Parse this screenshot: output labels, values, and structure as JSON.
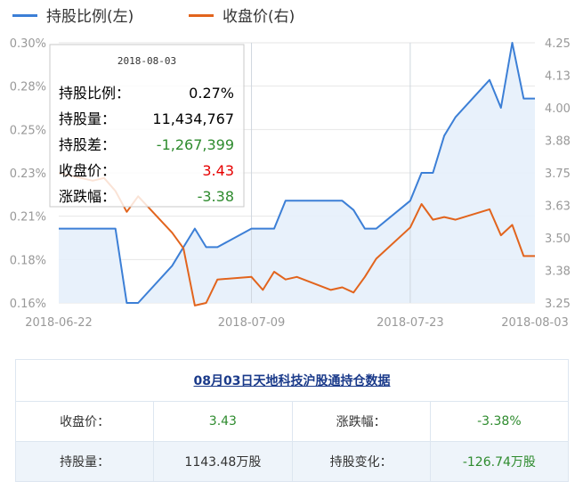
{
  "chart_data": {
    "type": "line",
    "legend": [
      {
        "name": "持股比例(左)",
        "color": "#3c7fd6"
      },
      {
        "name": "收盘价(右)",
        "color": "#e2641d"
      }
    ],
    "x_ticks": [
      "2018-06-22",
      "2018-07-09",
      "2018-07-23",
      "2018-08-03"
    ],
    "y_left": {
      "ticks": [
        "0.30%",
        "0.28%",
        "0.25%",
        "0.23%",
        "0.21%",
        "0.18%",
        "0.16%"
      ],
      "ylim": [
        0.16,
        0.3
      ]
    },
    "y_right": {
      "ticks": [
        "4.25",
        "4.13",
        "4.00",
        "3.88",
        "3.75",
        "3.63",
        "3.50",
        "3.38",
        "3.25"
      ],
      "ylim": [
        3.25,
        4.25
      ]
    },
    "x": [
      "2018-06-22",
      "2018-06-25",
      "2018-06-26",
      "2018-06-27",
      "2018-06-28",
      "2018-06-29",
      "2018-07-02",
      "2018-07-03",
      "2018-07-04",
      "2018-07-05",
      "2018-07-06",
      "2018-07-09",
      "2018-07-10",
      "2018-07-11",
      "2018-07-12",
      "2018-07-13",
      "2018-07-16",
      "2018-07-17",
      "2018-07-18",
      "2018-07-19",
      "2018-07-20",
      "2018-07-23",
      "2018-07-24",
      "2018-07-25",
      "2018-07-26",
      "2018-07-27",
      "2018-07-30",
      "2018-07-31",
      "2018-08-01",
      "2018-08-02",
      "2018-08-03"
    ],
    "series": [
      {
        "name": "持股比例(左)",
        "axis": "left",
        "fill": true,
        "values": [
          0.2,
          0.2,
          0.2,
          0.2,
          0.16,
          0.16,
          0.18,
          0.19,
          0.2,
          0.19,
          0.19,
          0.2,
          0.2,
          0.2,
          0.215,
          0.215,
          0.215,
          0.215,
          0.21,
          0.2,
          0.2,
          0.215,
          0.23,
          0.23,
          0.25,
          0.26,
          0.28,
          0.265,
          0.3,
          0.27,
          0.27
        ]
      },
      {
        "name": "收盘价(右)",
        "axis": "right",
        "fill": false,
        "values": [
          3.75,
          3.72,
          3.73,
          3.68,
          3.6,
          3.66,
          3.52,
          3.46,
          3.24,
          3.25,
          3.34,
          3.35,
          3.3,
          3.37,
          3.34,
          3.35,
          3.3,
          3.31,
          3.29,
          3.35,
          3.42,
          3.54,
          3.63,
          3.57,
          3.58,
          3.57,
          3.61,
          3.51,
          3.55,
          3.43,
          3.43
        ]
      }
    ],
    "crosshair_dates": [
      "2018-07-09",
      "2018-07-23"
    ],
    "tooltip": {
      "date": "2018-08-03",
      "rows": [
        {
          "label": "持股比例：",
          "value": "0.27%",
          "color": "#000000"
        },
        {
          "label": "持股量：",
          "value": "11,434,767",
          "color": "#000000"
        },
        {
          "label": "持股差：",
          "value": "-1,267,399",
          "color": "#2e8b2e"
        },
        {
          "label": "收盘价：",
          "value": "3.43",
          "color": "#e60000"
        },
        {
          "label": "涨跌幅：",
          "value": "-3.38",
          "color": "#2e8b2e"
        }
      ]
    }
  },
  "summary": {
    "title": "08月03日天地科技沪股通持仓数据",
    "close_label": "收盘价：",
    "close_value": "3.43",
    "change_label": "涨跌幅：",
    "change_value": "-3.38%",
    "holding_label": "持股量：",
    "holding_value": "1143.48万股",
    "holding_change_label": "持股变化：",
    "holding_change_value": "-126.74万股"
  }
}
